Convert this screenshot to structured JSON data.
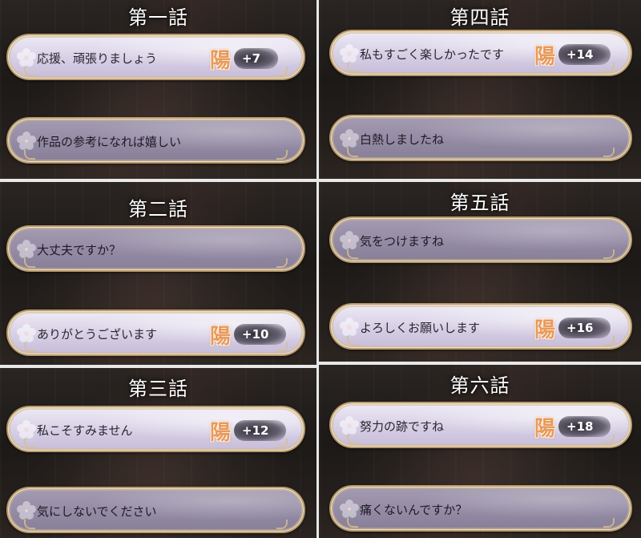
{
  "panels": [
    {
      "title": "第一話",
      "choices": [
        {
          "label": "応援、頑張りましょう",
          "badge": "陽",
          "score": "+7",
          "state": "bright"
        },
        {
          "label": "作品の参考になれば嬉しい",
          "state": "dim"
        }
      ]
    },
    {
      "title": "第四話",
      "choices": [
        {
          "label": "私もすごく楽しかったです",
          "badge": "陽",
          "score": "+14",
          "state": "bright"
        },
        {
          "label": "白熱しましたね",
          "state": "dim"
        }
      ]
    },
    {
      "title": "第二話",
      "choices": [
        {
          "label": "大丈夫ですか？",
          "state": "dim"
        },
        {
          "label": "ありがとうございます",
          "badge": "陽",
          "score": "+10",
          "state": "bright"
        }
      ]
    },
    {
      "title": "第五話",
      "choices": [
        {
          "label": "気をつけますね",
          "state": "dim"
        },
        {
          "label": "よろしくお願いします",
          "badge": "陽",
          "score": "+16",
          "state": "bright"
        }
      ]
    },
    {
      "title": "第三話",
      "choices": [
        {
          "label": "私こそすみません",
          "badge": "陽",
          "score": "+12",
          "state": "bright"
        },
        {
          "label": "気にしないでください",
          "state": "dim"
        }
      ]
    },
    {
      "title": "第六話",
      "choices": [
        {
          "label": "努力の跡ですね",
          "badge": "陽",
          "score": "+18",
          "state": "bright"
        },
        {
          "label": "痛くないんですか？",
          "state": "dim"
        }
      ]
    }
  ],
  "icons": {
    "choice_marker": "sakura-flower-icon",
    "badge": "yang-kanji-badge-icon"
  },
  "colors": {
    "badge": "#e79a5c",
    "frame": "#b89a6d",
    "bright_choice": "#d8d1e6",
    "dim_choice": "#958ca5"
  }
}
